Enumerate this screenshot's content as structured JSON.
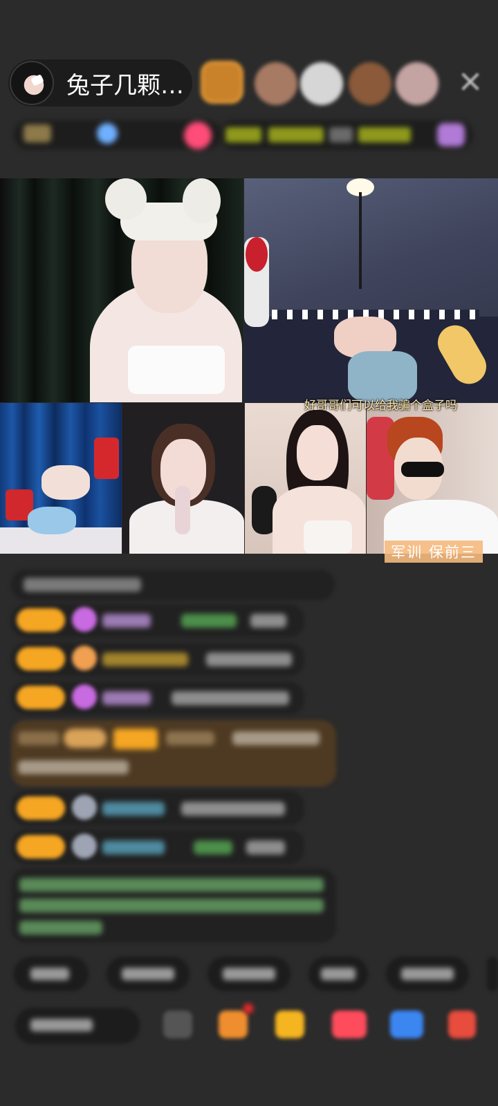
{
  "host": {
    "name": "兔子几颗…"
  },
  "stream": {
    "caption": "好哥哥们可以给我骗个盒子吗",
    "tile_label": "军训  保前三"
  }
}
